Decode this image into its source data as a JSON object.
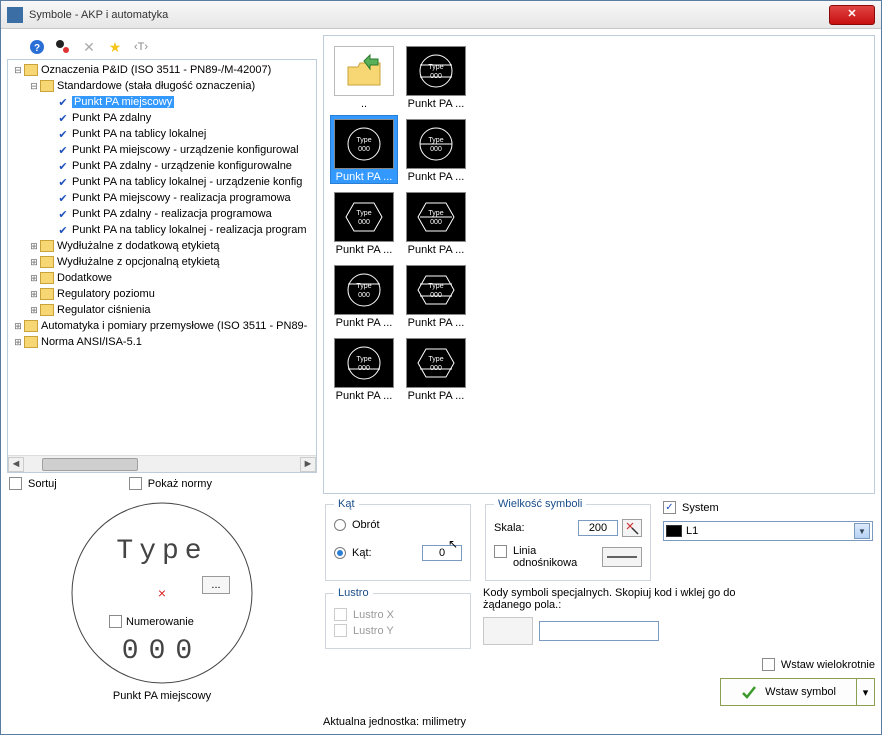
{
  "window": {
    "title": "Symbole - AKP i automatyka"
  },
  "toolbar": {
    "help_icon": "help-icon",
    "options_icon": "options-icon",
    "delete_icon": "delete-icon",
    "favorite_icon": "favorite-icon",
    "text_icon": "text-icon"
  },
  "tree": {
    "root": {
      "label": "Oznaczenia P&ID (ISO 3511 - PN89-/M-42007)",
      "expanded": true,
      "children": [
        {
          "label": "Standardowe (stała długość oznaczenia)",
          "expanded": true,
          "leaves": [
            "Punkt PA miejscowy",
            "Punkt PA zdalny",
            "Punkt PA na tablicy lokalnej",
            "Punkt PA miejscowy - urządzenie konfigurowal",
            "Punkt PA zdalny - urządzenie konfigurowalne",
            "Punkt PA na tablicy lokalnej - urządzenie konfig",
            "Punkt PA miejscowy - realizacja programowa",
            "Punkt PA zdalny - realizacja programowa",
            "Punkt PA na tablicy lokalnej - realizacja program"
          ]
        },
        {
          "label": "Wydłużalne z dodatkową etykietą"
        },
        {
          "label": "Wydłużalne z opcjonalną etykietą"
        },
        {
          "label": "Dodatkowe"
        },
        {
          "label": "Regulatory poziomu"
        },
        {
          "label": "Regulator ciśnienia"
        }
      ]
    },
    "siblings": [
      "Automatyka i pomiary przemysłowe (ISO 3511 - PN89-",
      "Norma ANSI/ISA-5.1"
    ],
    "selected_leaf_index": 0
  },
  "sort": {
    "sortuj_label": "Sortuj",
    "pokaz_normy_label": "Pokaż normy",
    "sortuj_checked": false,
    "pokaz_checked": false
  },
  "thumbs": [
    {
      "cap": "..",
      "kind": "up"
    },
    {
      "cap": "Punkt PA ..."
    },
    {
      "cap": "Punkt PA ...",
      "selected": true
    },
    {
      "cap": "Punkt PA ..."
    },
    {
      "cap": "Punkt PA ..."
    },
    {
      "cap": "Punkt PA ..."
    },
    {
      "cap": "Punkt PA ..."
    },
    {
      "cap": "Punkt PA ..."
    },
    {
      "cap": "Punkt PA ..."
    },
    {
      "cap": "Punkt PA ..."
    }
  ],
  "preview": {
    "caption": "Punkt PA miejscowy",
    "numerowanie_label": "Numerowanie",
    "text_top": "Type",
    "text_bot": "000",
    "dots_button": "..."
  },
  "kat": {
    "legend": "Kąt",
    "obrot_label": "Obrót",
    "kat_label": "Kąt:",
    "kat_value": "0",
    "selected": "kat"
  },
  "wielkosc": {
    "legend": "Wielkość symboli",
    "skala_label": "Skala:",
    "skala_value": "200",
    "linia_label": "Linia odnośnikowa",
    "linia_checked": false
  },
  "system": {
    "checkbox_label": "System",
    "checked": true,
    "value": "L1"
  },
  "lustro": {
    "legend": "Lustro",
    "x_label": "Lustro X",
    "y_label": "Lustro Y"
  },
  "kody": {
    "label": "Kody symboli specjalnych. Skopiuj kod i wklej go do żądanego pola.:",
    "field_value": ""
  },
  "actions": {
    "wstaw_wiel_label": "Wstaw wielokrotnie",
    "wstaw_wiel_checked": false,
    "wstaw_symbol_label": "Wstaw symbol"
  },
  "unit": {
    "label": "Aktualna jednostka: milimetry"
  }
}
